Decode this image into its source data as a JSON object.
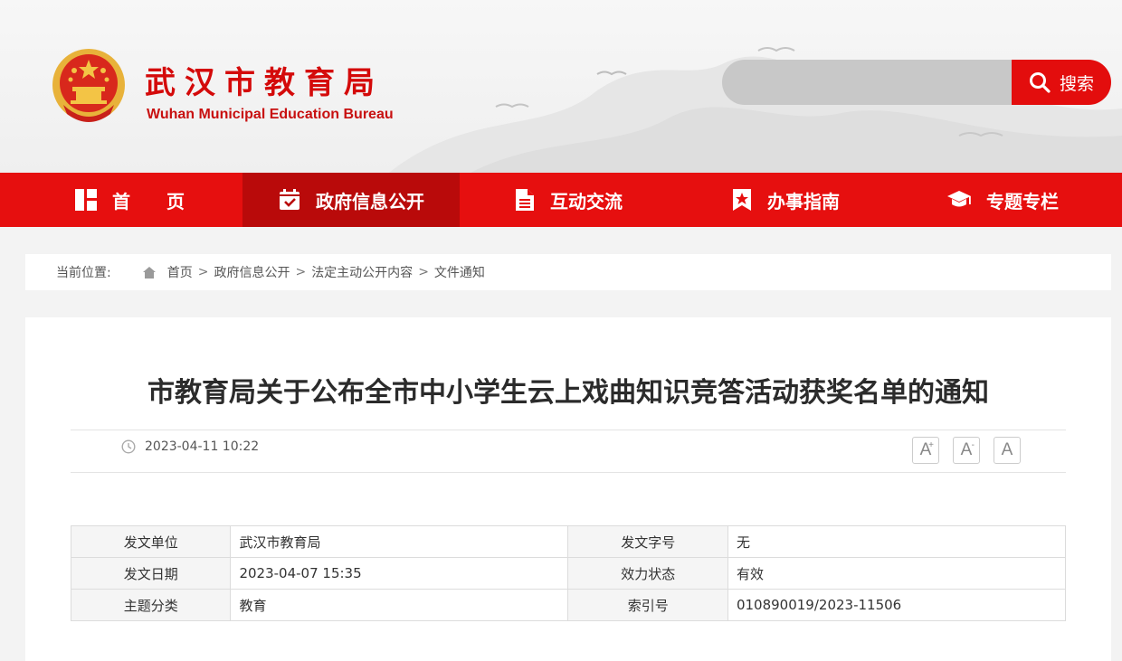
{
  "header": {
    "title": "武汉市教育局",
    "subtitle": "Wuhan Municipal Education Bureau",
    "search": {
      "placeholder": "",
      "button_label": "搜索"
    }
  },
  "nav": {
    "items": [
      {
        "label": "首页",
        "icon": "dashboard-icon",
        "active": false
      },
      {
        "label": "政府信息公开",
        "icon": "calendar-check-icon",
        "active": true
      },
      {
        "label": "互动交流",
        "icon": "document-icon",
        "active": false
      },
      {
        "label": "办事指南",
        "icon": "bookmark-star-icon",
        "active": false
      },
      {
        "label": "专题专栏",
        "icon": "graduation-cap-icon",
        "active": false
      }
    ]
  },
  "breadcrumb": {
    "prefix": "当前位置:",
    "items": [
      "首页",
      "政府信息公开",
      "法定主动公开内容",
      "文件通知"
    ],
    "separator": ">"
  },
  "article": {
    "title": "市教育局关于公布全市中小学生云上戏曲知识竞答活动获奖名单的通知",
    "publish_time": "2023-04-11 10:22",
    "font_buttons": [
      "A+",
      "A-",
      "A"
    ]
  },
  "info_table": {
    "rows": [
      {
        "k1": "发文单位",
        "v1": "武汉市教育局",
        "k2": "发文字号",
        "v2": "无"
      },
      {
        "k1": "发文日期",
        "v1": "2023-04-07 15:35",
        "k2": "效力状态",
        "v2": "有效"
      },
      {
        "k1": "主题分类",
        "v1": "教育",
        "k2": "索引号",
        "v2": "010890019/2023-11506"
      }
    ]
  },
  "colors": {
    "brand_red": "#e60f0f",
    "nav_active": "#b90a0a",
    "title_red": "#d40a0a"
  }
}
